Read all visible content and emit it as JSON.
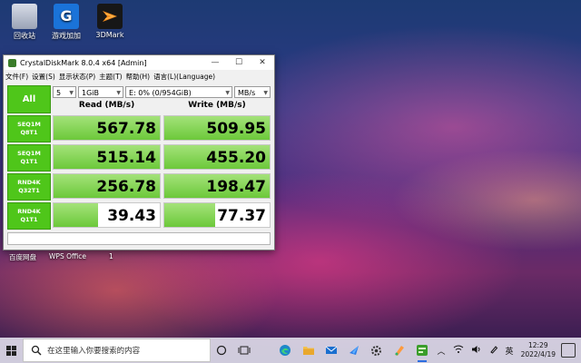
{
  "desktop": {
    "icons": [
      {
        "label": "回收站",
        "icon": "recycle-bin-icon"
      },
      {
        "label": "游戏加加",
        "icon": "youxijiajia-icon",
        "glyph": "G"
      },
      {
        "label": "3DMark",
        "icon": "3dmark-icon"
      }
    ],
    "labels": [
      "百度网盘",
      "WPS Office",
      "1"
    ]
  },
  "window": {
    "title": "CrystalDiskMark 8.0.4 x64 [Admin]",
    "buttons": {
      "minimize": "—",
      "maximize": "☐",
      "close": "✕"
    },
    "menu": [
      "文件(F)",
      "设置(S)",
      "显示状态(P)",
      "主题(T)",
      "帮助(H)",
      "语言(L)(Language)"
    ],
    "all_label": "All",
    "count": "5",
    "size": "1GiB",
    "drive": "E: 0% (0/954GiB)",
    "unit": "MB/s",
    "read_header": "Read (MB/s)",
    "write_header": "Write (MB/s)",
    "rows": [
      {
        "l1": "SEQ1M",
        "l2": "Q8T1",
        "read": "567.78",
        "write": "509.95",
        "read_fill": 1.0,
        "write_fill": 1.0
      },
      {
        "l1": "SEQ1M",
        "l2": "Q1T1",
        "read": "515.14",
        "write": "455.20",
        "read_fill": 1.0,
        "write_fill": 1.0
      },
      {
        "l1": "RND4K",
        "l2": "Q32T1",
        "read": "256.78",
        "write": "198.47",
        "read_fill": 1.0,
        "write_fill": 1.0
      },
      {
        "l1": "RND4K",
        "l2": "Q1T1",
        "read": "39.43",
        "write": "77.37",
        "read_fill": 0.42,
        "write_fill": 0.48
      }
    ]
  },
  "taskbar": {
    "search_placeholder": "在这里输入你要搜索的内容",
    "ime": "英",
    "time": "12:29",
    "date": "2022/4/19"
  }
}
